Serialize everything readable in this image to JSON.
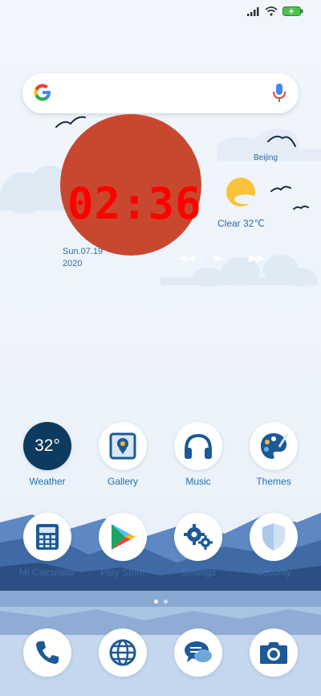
{
  "search": {
    "provider": "Google",
    "mic_icon": "mic-icon"
  },
  "clock_widget": {
    "time": "02:36",
    "date_line1": "Sun.07.19",
    "date_line2": "2020",
    "city": "Beijing",
    "weather": "Clear  32℃"
  },
  "apps_row1": [
    {
      "label": "Weather",
      "icon": "weather-icon",
      "temp": "32°"
    },
    {
      "label": "Gallery",
      "icon": "gallery-icon"
    },
    {
      "label": "Music",
      "icon": "headphones-icon"
    },
    {
      "label": "Themes",
      "icon": "palette-icon"
    }
  ],
  "apps_row2": [
    {
      "label": "Mi Calculator",
      "icon": "calculator-icon"
    },
    {
      "label": "Play Store",
      "icon": "play-store-icon"
    },
    {
      "label": "Settings",
      "icon": "gear-icon"
    },
    {
      "label": "Security",
      "icon": "shield-icon"
    }
  ],
  "dock": [
    {
      "icon": "phone-icon"
    },
    {
      "icon": "browser-icon"
    },
    {
      "icon": "messages-icon"
    },
    {
      "icon": "camera-icon"
    }
  ],
  "pages": {
    "count": 2,
    "active": 1
  },
  "colors": {
    "accent": "#1f6fb4",
    "sun": "#c8482f",
    "clock": "#ff0000"
  }
}
